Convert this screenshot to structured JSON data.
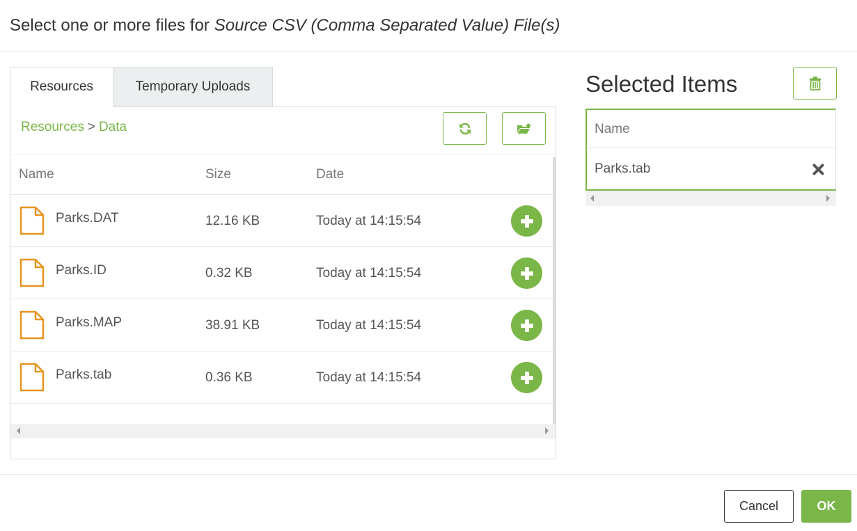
{
  "dialog": {
    "title_prefix": "Select one or more files for",
    "title_target": "Source CSV (Comma Separated Value) File(s)"
  },
  "tabs": [
    {
      "label": "Resources",
      "active": true
    },
    {
      "label": "Temporary Uploads",
      "active": false
    }
  ],
  "breadcrumb": {
    "items": [
      "Resources",
      "Data"
    ],
    "separator": ">"
  },
  "toolbar": {
    "refresh_icon": "refresh-icon",
    "upload_icon": "folder-upload-icon"
  },
  "file_table": {
    "columns": [
      "Name",
      "Size",
      "Date"
    ],
    "rows": [
      {
        "name": "Parks.DAT",
        "size": "12.16 KB",
        "date": "Today at 14:15:54"
      },
      {
        "name": "Parks.ID",
        "size": "0.32 KB",
        "date": "Today at 14:15:54"
      },
      {
        "name": "Parks.MAP",
        "size": "38.91 KB",
        "date": "Today at 14:15:54"
      },
      {
        "name": "Parks.tab",
        "size": "0.36 KB",
        "date": "Today at 14:15:54"
      }
    ]
  },
  "selected": {
    "title": "Selected Items",
    "column": "Name",
    "items": [
      "Parks.tab"
    ]
  },
  "footer": {
    "cancel_label": "Cancel",
    "ok_label": "OK"
  },
  "colors": {
    "accent": "#7ab648",
    "file_icon": "#e8931e",
    "tab_inactive_bg": "#ecefef"
  }
}
